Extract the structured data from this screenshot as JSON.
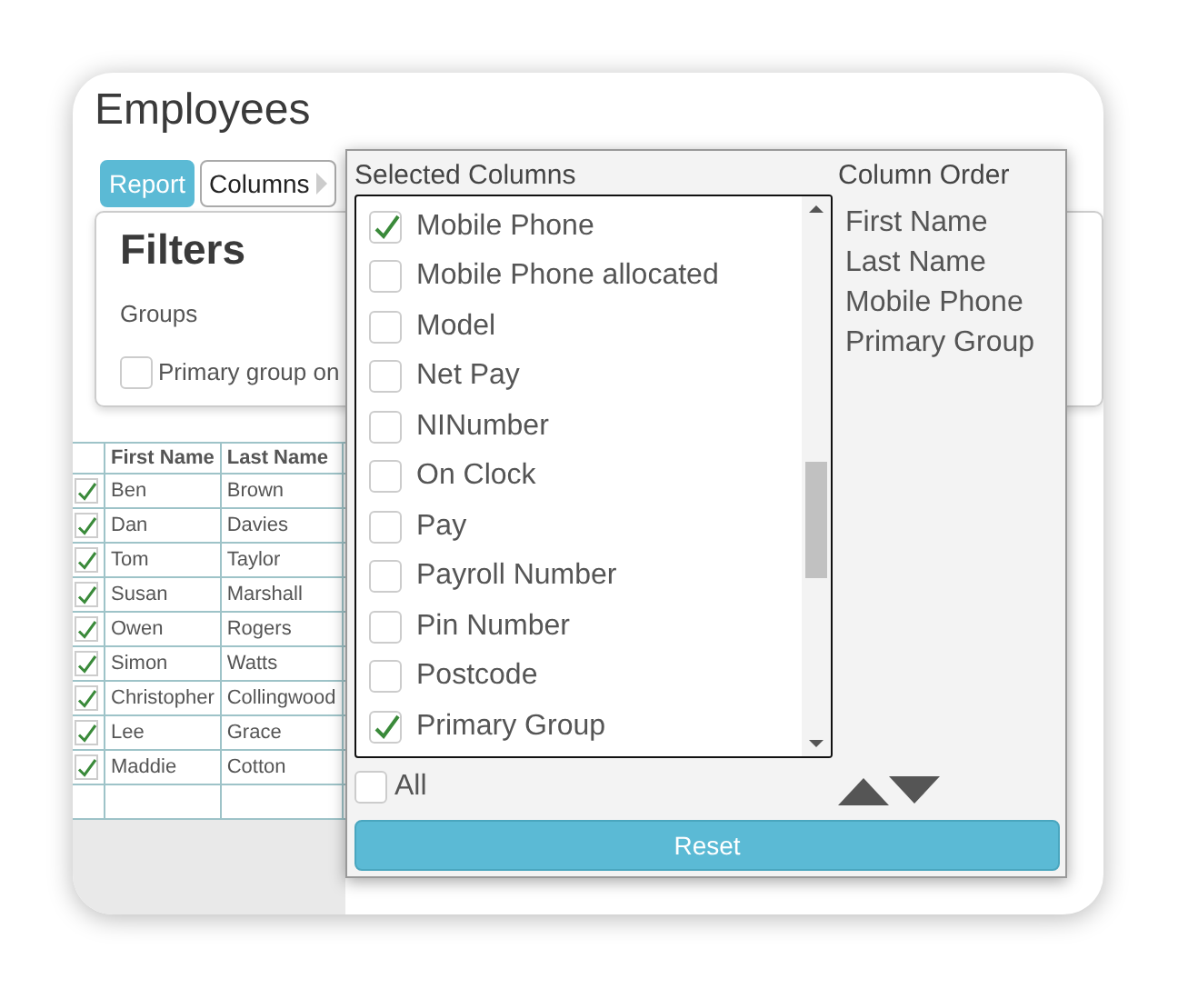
{
  "title": "Employees",
  "toolbar": [
    {
      "label": "Report",
      "selected": true
    },
    {
      "label": "Columns",
      "selected": false
    }
  ],
  "filters": {
    "title": "Filters",
    "groups_label": "Groups",
    "primary_group": {
      "label": "Primary group on",
      "checked": false
    }
  },
  "table": {
    "columns": [
      "First Name",
      "Last Name"
    ],
    "rows": [
      {
        "checked": true,
        "first_name": "Ben",
        "last_name": "Brown"
      },
      {
        "checked": true,
        "first_name": "Dan",
        "last_name": "Davies"
      },
      {
        "checked": true,
        "first_name": "Tom",
        "last_name": "Taylor"
      },
      {
        "checked": true,
        "first_name": "Susan",
        "last_name": "Marshall"
      },
      {
        "checked": true,
        "first_name": "Owen",
        "last_name": "Rogers"
      },
      {
        "checked": true,
        "first_name": "Simon",
        "last_name": "Watts"
      },
      {
        "checked": true,
        "first_name": "Christopher",
        "last_name": "Collingwood"
      },
      {
        "checked": true,
        "first_name": "Lee",
        "last_name": "Grace"
      },
      {
        "checked": true,
        "first_name": "Maddie",
        "last_name": "Cotton"
      }
    ]
  },
  "column_picker": {
    "selected_heading": "Selected Columns",
    "order_heading": "Column Order",
    "columns": [
      {
        "label": "Mobile Phone",
        "checked": true
      },
      {
        "label": "Mobile Phone allocated",
        "checked": false
      },
      {
        "label": "Model",
        "checked": false
      },
      {
        "label": "Net Pay",
        "checked": false
      },
      {
        "label": "NINumber",
        "checked": false
      },
      {
        "label": "On Clock",
        "checked": false
      },
      {
        "label": "Pay",
        "checked": false
      },
      {
        "label": "Payroll Number",
        "checked": false
      },
      {
        "label": "Pin Number",
        "checked": false
      },
      {
        "label": "Postcode",
        "checked": false
      },
      {
        "label": "Primary Group",
        "checked": true
      }
    ],
    "all": {
      "label": "All",
      "checked": false
    },
    "order": [
      "First Name",
      "Last Name",
      "Mobile Phone",
      "Primary Group"
    ],
    "reset": "Reset"
  }
}
